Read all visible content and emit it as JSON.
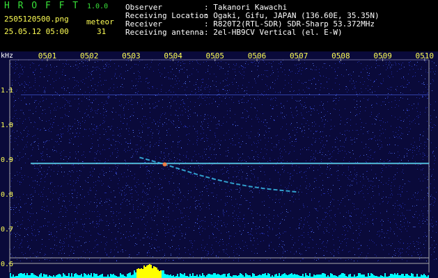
{
  "header": {
    "app_name": "H R O F F T",
    "version": "1.0.0",
    "filename": "2505120500.png",
    "datetime": "25.05.12 05:00",
    "meteor_label": "meteor",
    "meteor_count": "31",
    "info": [
      {
        "label": "Observer",
        "value": ": Takanori Kawachi"
      },
      {
        "label": "Receiving Location",
        "value": ": Ogaki, Gifu, JAPAN (136.60E, 35.35N)"
      },
      {
        "label": "Receiver",
        "value": ": R820T2(RTL-SDR) SDR-Sharp 53.372MHz"
      },
      {
        "label": "Receiving antenna",
        "value": ": 2el-HB9CV Vertical (el. E-W)"
      }
    ]
  },
  "chart_data": {
    "type": "heatmap",
    "title": "",
    "ylabel": "kHz",
    "x_ticks": [
      "0501",
      "0502",
      "0503",
      "0504",
      "0505",
      "0506",
      "0507",
      "0508",
      "0509",
      "0510"
    ],
    "y_ticks": [
      "1.1",
      "1.0",
      "0.9",
      "0.8",
      "0.7",
      "0.6"
    ],
    "ylim": [
      0.6,
      1.15
    ],
    "colors": {
      "background": "#0a0a3a",
      "noise": "#2a38c8",
      "carrier": "#4fe0ff",
      "grid": "#aaaaaa",
      "tick_label": "#ffff55",
      "axis_text": "#ffffff",
      "activity": "#00ffff",
      "activity_peak": "#ffff00"
    },
    "carrier_khz": 0.888,
    "secondary_line_khz": 1.085,
    "meteor_trail": [
      {
        "t_min": 2.2,
        "khz": 0.905
      },
      {
        "t_min": 2.5,
        "khz": 0.895
      },
      {
        "t_min": 2.8,
        "khz": 0.885
      },
      {
        "t_min": 3.2,
        "khz": 0.87
      },
      {
        "t_min": 3.6,
        "khz": 0.855
      },
      {
        "t_min": 4.0,
        "khz": 0.842
      },
      {
        "t_min": 4.4,
        "khz": 0.831
      },
      {
        "t_min": 4.8,
        "khz": 0.822
      },
      {
        "t_min": 5.2,
        "khz": 0.815
      },
      {
        "t_min": 5.6,
        "khz": 0.81
      },
      {
        "t_min": 6.0,
        "khz": 0.805
      }
    ]
  }
}
